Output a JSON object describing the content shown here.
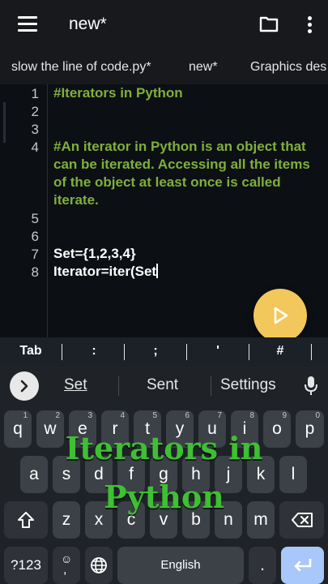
{
  "appbar": {
    "title": "new*",
    "menu_icon": "hamburger-icon",
    "folder_icon": "folder-icon",
    "more_icon": "more-vert-icon"
  },
  "tabs": [
    {
      "label": "slow the line of code.py*"
    },
    {
      "label": "new*"
    },
    {
      "label": "Graphics des"
    }
  ],
  "editor": {
    "lines": [
      {
        "num": "1",
        "text": "#Iterators in Python"
      },
      {
        "num": "2",
        "text": ""
      },
      {
        "num": "3",
        "text": ""
      },
      {
        "num": "4",
        "text": "#An iterator in Python is an object that can be iterated. Accessing all the items of the object at least once is called iterate."
      },
      {
        "num": "5",
        "text": ""
      },
      {
        "num": "6",
        "text": ""
      },
      {
        "num": "7",
        "text": "Set={1,2,3,4}"
      },
      {
        "num": "8",
        "text": "Iterator=iter(Set"
      }
    ],
    "comment_color": "#7fb03a"
  },
  "run_button": {
    "icon": "play-icon",
    "color": "#f2c75c"
  },
  "symbols": [
    "Tab",
    ":",
    ";",
    "'",
    "#"
  ],
  "keyboard": {
    "suggestions": [
      "Set",
      "Sent",
      "Settings"
    ],
    "row1": [
      {
        "k": "q",
        "h": "1"
      },
      {
        "k": "w",
        "h": "2"
      },
      {
        "k": "e",
        "h": "3"
      },
      {
        "k": "r",
        "h": "4"
      },
      {
        "k": "t",
        "h": "5"
      },
      {
        "k": "y",
        "h": "6"
      },
      {
        "k": "u",
        "h": "7"
      },
      {
        "k": "i",
        "h": "8"
      },
      {
        "k": "o",
        "h": "9"
      },
      {
        "k": "p",
        "h": "0"
      }
    ],
    "row2": [
      "a",
      "s",
      "d",
      "f",
      "g",
      "h",
      "j",
      "k",
      "l"
    ],
    "row3": [
      "z",
      "x",
      "c",
      "v",
      "b",
      "n",
      "m"
    ],
    "symbols_key": "?123",
    "space_label": "English",
    "period_key": "."
  },
  "overlay": {
    "line1": "Iterators in",
    "line2": "Python",
    "color": "#3fbf33"
  }
}
